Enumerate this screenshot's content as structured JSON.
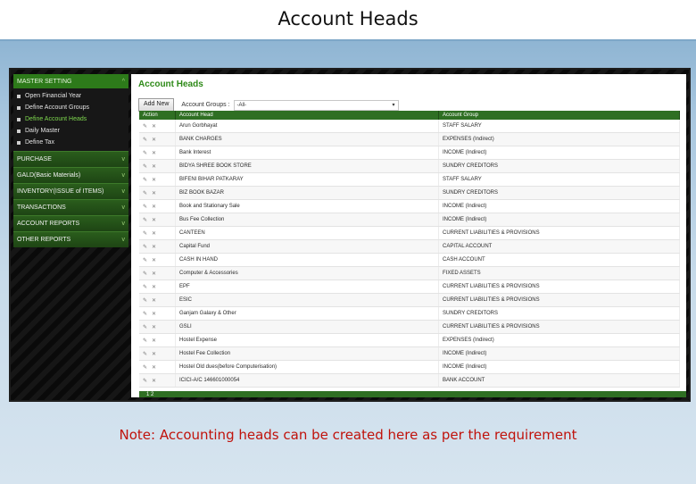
{
  "slide": {
    "title": "Account Heads",
    "note": "Note: Accounting heads can be created here as per the requirement"
  },
  "sidebar": {
    "header": "MASTER SETTING",
    "header_icon": "^",
    "items": [
      {
        "label": "Open Financial Year",
        "active": false
      },
      {
        "label": "Define Account Groups",
        "active": false
      },
      {
        "label": "Define Account Heads",
        "active": true
      },
      {
        "label": "Daily Master",
        "active": false
      },
      {
        "label": "Define Tax",
        "active": false
      }
    ],
    "sections": [
      {
        "label": "PURCHASE"
      },
      {
        "label": "GALD(Basic Materials)"
      },
      {
        "label": "INVENTORY(ISSUE of ITEMS)"
      },
      {
        "label": "TRANSACTIONS"
      },
      {
        "label": "ACCOUNT REPORTS"
      },
      {
        "label": "OTHER REPORTS"
      }
    ],
    "chevron": "v"
  },
  "main": {
    "title": "Account Heads",
    "add_button": "Add New",
    "group_label": "Account Groups :",
    "group_value": "-All-",
    "columns": [
      "Action",
      "Account Head",
      "Account Group"
    ],
    "rows": [
      {
        "head": "Arun Gorbhayat",
        "group": "STAFF SALARY"
      },
      {
        "head": "BANK CHARGES",
        "group": "EXPENSES (Indirect)"
      },
      {
        "head": "Bank Interest",
        "group": "INCOME (Indirect)"
      },
      {
        "head": "BIDYA SHREE BOOK STORE",
        "group": "SUNDRY CREDITORS"
      },
      {
        "head": "BIFENI BIHAR PATKARAY",
        "group": "STAFF SALARY"
      },
      {
        "head": "BIZ BOOK BAZAR",
        "group": "SUNDRY CREDITORS"
      },
      {
        "head": "Book and Stationary Sale",
        "group": "INCOME (Indirect)"
      },
      {
        "head": "Bus Fee Collection",
        "group": "INCOME (Indirect)"
      },
      {
        "head": "CANTEEN",
        "group": "CURRENT LIABILITIES & PROVISIONS"
      },
      {
        "head": "Capital Fund",
        "group": "CAPITAL ACCOUNT"
      },
      {
        "head": "CASH IN HAND",
        "group": "CASH ACCOUNT"
      },
      {
        "head": "Computer & Accessories",
        "group": "FIXED ASSETS"
      },
      {
        "head": "EPF",
        "group": "CURRENT LIABILITIES & PROVISIONS"
      },
      {
        "head": "ESIC",
        "group": "CURRENT LIABILITIES & PROVISIONS"
      },
      {
        "head": "Ganjam Galaxy & Other",
        "group": "SUNDRY CREDITORS"
      },
      {
        "head": "GSLI",
        "group": "CURRENT LIABILITIES & PROVISIONS"
      },
      {
        "head": "Hostel Expense",
        "group": "EXPENSES (Indirect)"
      },
      {
        "head": "Hostel Fee Collection",
        "group": "INCOME (Indirect)"
      },
      {
        "head": "Hostel Old dues(before Computerisation)",
        "group": "INCOME (Indirect)"
      },
      {
        "head": "ICICI-A/C 146601000054",
        "group": "BANK ACCOUNT"
      }
    ],
    "action_icons": [
      "pencil-icon",
      "delete-icon"
    ],
    "edit_glyph": "✎",
    "delete_glyph": "✕",
    "pager": "1 2"
  }
}
